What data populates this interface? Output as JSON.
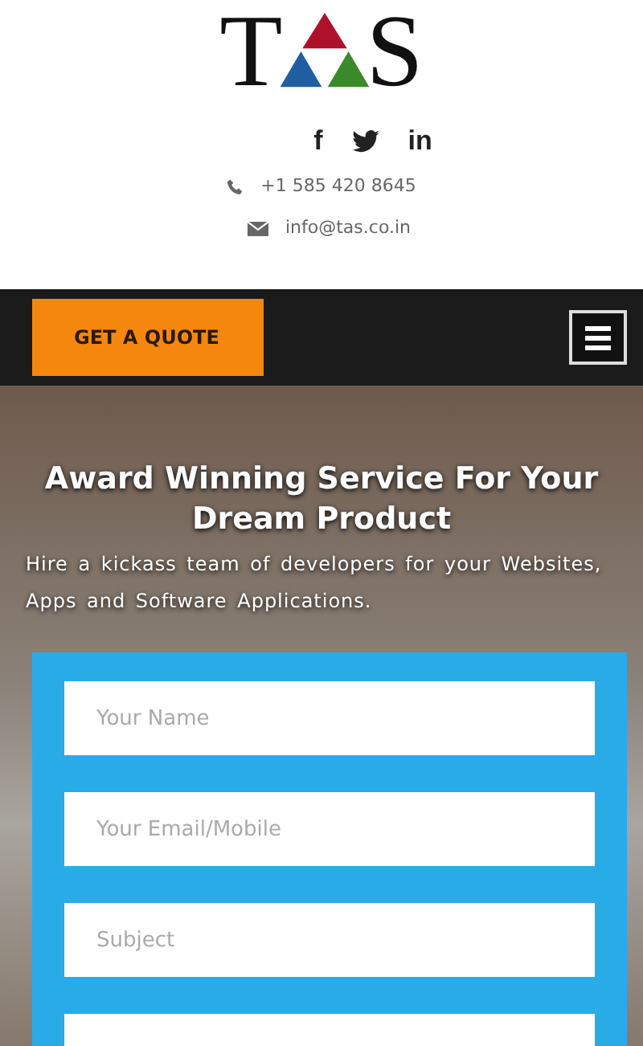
{
  "logo": {
    "left": "T",
    "right": "S"
  },
  "social": [
    {
      "kind": "facebook",
      "glyph": "f"
    },
    {
      "kind": "twitter"
    },
    {
      "kind": "linkedin",
      "glyph": "in"
    }
  ],
  "contact": [
    {
      "kind": "phone",
      "text": "+1 585 420 8645"
    },
    {
      "kind": "email",
      "text": "info@tas.co.in"
    }
  ],
  "nav": {
    "quote_button": "GET A QUOTE"
  },
  "hero": {
    "title": "Award Winning Service For Your Dream Product",
    "subtitle": "Hire a kickass team of developers for your Websites, Apps and Software Applications."
  },
  "form": {
    "fields": [
      {
        "placeholder": "Your Name"
      },
      {
        "placeholder": "Your Email/Mobile"
      },
      {
        "placeholder": "Subject"
      },
      {
        "kind": "blank"
      }
    ]
  }
}
